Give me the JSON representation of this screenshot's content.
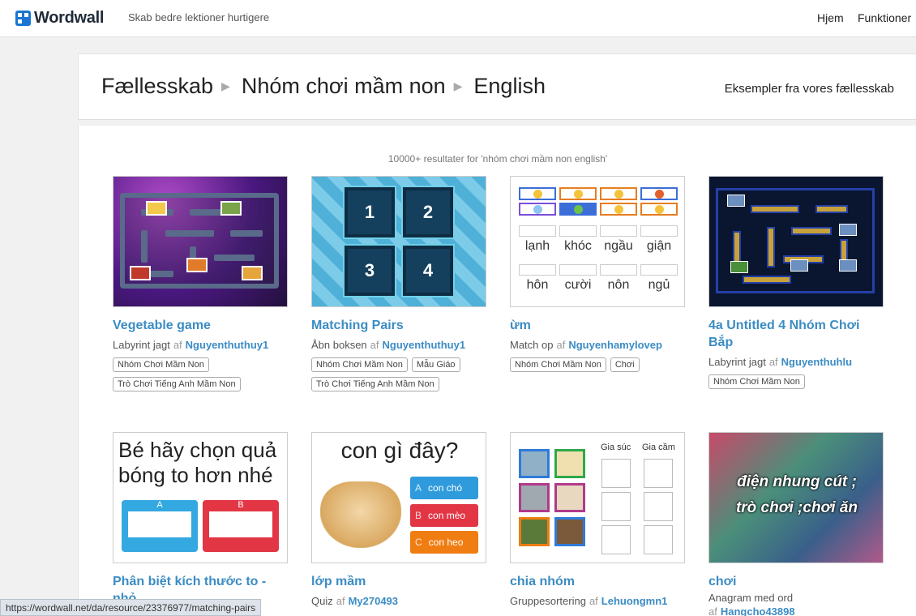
{
  "header": {
    "logo": "Wordwall",
    "tagline": "Skab bedre lektioner hurtigere",
    "nav": {
      "home": "Hjem",
      "features": "Funktioner"
    }
  },
  "breadcrumb": {
    "items": [
      "Fællesskab",
      "Nhóm chơi mầm non",
      "English"
    ],
    "examples_link": "Eksempler fra vores fællesskab"
  },
  "results": {
    "count_text": "10000+ resultater for 'nhóm chơi mầm non english'"
  },
  "cards": [
    {
      "title": "Vegetable game",
      "type": "Labyrint jagt",
      "af": "af",
      "author": "Nguyenthuthuy1",
      "tags": [
        "Nhóm Chơi Mầm Non",
        "Trò Chơi Tiếng Anh Mầm Non"
      ]
    },
    {
      "title": "Matching Pairs",
      "type": "Åbn boksen",
      "af": "af",
      "author": "Nguyenthuthuy1",
      "tags": [
        "Nhóm Chơi Mầm Non",
        "Mẫu Giáo",
        "Trò Chơi Tiếng Anh Mầm Non"
      ],
      "thumb_tiles": [
        "1",
        "2",
        "3",
        "4"
      ]
    },
    {
      "title": "ừm",
      "type": "Match op",
      "af": "af",
      "author": "Nguyenhamylovep",
      "tags": [
        "Nhóm Chơi Mầm Non",
        "Chơi"
      ],
      "thumb_words": [
        "lạnh",
        "khóc",
        "ngầu",
        "giận",
        "hôn",
        "cười",
        "nôn",
        "ngủ"
      ]
    },
    {
      "title": "4a Untitled 4 Nhóm Chơi Bắp",
      "type": "Labyrint jagt",
      "af": "af",
      "author": "Nguyenthuhlu",
      "tags": [
        "Nhóm Chơi Mầm Non"
      ]
    },
    {
      "title": "Phân biệt kích thước to - nhỏ",
      "type": "",
      "af": "",
      "author": "",
      "tags": [],
      "thumb_text": "Bé hãy chọn quả bóng to hơn nhé",
      "thumb_options": [
        "A",
        "B"
      ]
    },
    {
      "title": "lớp mầm",
      "type": "Quiz",
      "af": "af",
      "author": "My270493",
      "tags": [],
      "thumb_question": "con gì đây?",
      "thumb_answers": [
        {
          "letter": "A",
          "text": "con chó",
          "color": "#2f9bdc"
        },
        {
          "letter": "B",
          "text": "con mèo",
          "color": "#e23644"
        },
        {
          "letter": "C",
          "text": "con heo",
          "color": "#f07d12"
        }
      ]
    },
    {
      "title": "chia nhóm",
      "type": "Gruppesortering",
      "af": "af",
      "author": "Lehuongmn1",
      "tags": [],
      "thumb_groups": [
        "Gia súc",
        "Gia cầm"
      ]
    },
    {
      "title": "chơi",
      "type": "Anagram med ord",
      "af": "af",
      "author": "Hangcho43898",
      "tags": [],
      "thumb_lines": [
        "điện  nhung  cút ;",
        "trò  chơi  ;chơi  ăn"
      ]
    }
  ],
  "status_bar": "https://wordwall.net/da/resource/23376977/matching-pairs",
  "colors": {
    "link": "#3b8cc4",
    "brand": "#1976d2"
  }
}
